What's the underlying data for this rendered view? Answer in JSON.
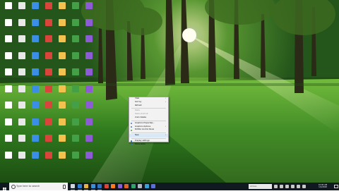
{
  "search": {
    "placeholder": "Type here to search"
  },
  "context_menu": [
    {
      "label": "View",
      "arrow": true,
      "disabled": false
    },
    {
      "label": "Sort by",
      "arrow": true,
      "disabled": false
    },
    {
      "label": "Refresh",
      "arrow": false,
      "disabled": false
    },
    {
      "sep": true
    },
    {
      "label": "Paste",
      "arrow": false,
      "disabled": true
    },
    {
      "label": "Paste shortcut",
      "arrow": false,
      "disabled": true
    },
    {
      "label": "Undo Delete",
      "arrow": false,
      "disabled": false
    },
    {
      "sep": true
    },
    {
      "label": "Graphics Properties...",
      "icon": "graphics-icon",
      "color": "#3b7bd6",
      "arrow": false,
      "disabled": false
    },
    {
      "label": "Graphics Options",
      "icon": "graphics-options-icon",
      "color": "#3b7bd6",
      "arrow": true,
      "disabled": false
    },
    {
      "label": "NVIDIA Control Panel",
      "icon": "nvidia-icon",
      "color": "#5aa02c",
      "arrow": false,
      "disabled": false
    },
    {
      "sep": true
    },
    {
      "label": "New",
      "arrow": true,
      "disabled": false,
      "highlight": true
    },
    {
      "sep": true
    },
    {
      "label": "Display settings",
      "icon": "display-icon",
      "color": "#2f6fd0",
      "arrow": false,
      "disabled": false
    },
    {
      "label": "Personalize",
      "icon": "personalize-icon",
      "color": "#2f6fd0",
      "arrow": false,
      "disabled": false
    }
  ],
  "taskbar": {
    "apps": [
      {
        "name": "task-view-icon",
        "color": "#cfd6de"
      },
      {
        "name": "edge-icon",
        "color": "#2d7fd3"
      },
      {
        "name": "file-explorer-icon",
        "color": "#e6b43c"
      },
      {
        "name": "store-icon",
        "color": "#3a8fd8"
      },
      {
        "name": "mail-icon",
        "color": "#2f73c6"
      },
      {
        "name": "chrome-icon",
        "color": "#db4437"
      },
      {
        "name": "firefox-icon",
        "color": "#ff7a1a"
      },
      {
        "name": "app-icon",
        "color": "#8a5cd6"
      },
      {
        "name": "media-icon",
        "color": "#e0612a"
      },
      {
        "name": "photos-icon",
        "color": "#2fa36b"
      },
      {
        "name": "settings-icon",
        "color": "#b0b7c0"
      },
      {
        "name": "app-icon",
        "color": "#37a2d8"
      },
      {
        "name": "app-icon",
        "color": "#5b6fd6"
      }
    ],
    "address": "Address",
    "time": "10:00 AM",
    "date": "1/1/2018"
  }
}
